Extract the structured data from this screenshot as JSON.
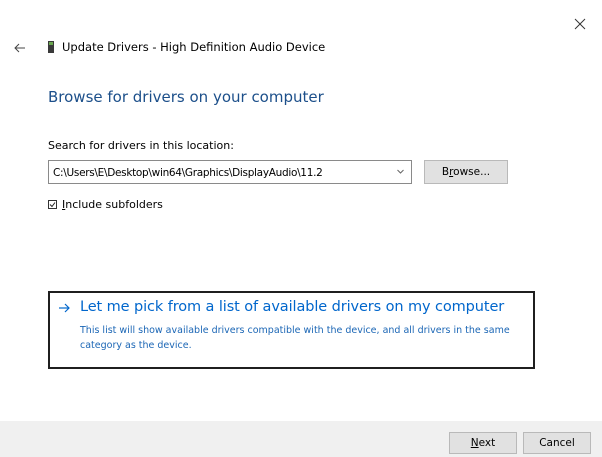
{
  "window": {
    "title": "Update Drivers - High Definition Audio Device",
    "close_icon": "close-icon",
    "back_icon": "back-arrow-icon",
    "device_icon": "audio-device-icon"
  },
  "main": {
    "heading": "Browse for drivers on your computer",
    "search_label": "Search for drivers in this location:",
    "path_value": "C:\\Users\\E\\Desktop\\win64\\Graphics\\DisplayAudio\\11.2",
    "browse_label_pre": "B",
    "browse_label_u": "r",
    "browse_label_post": "owse...",
    "include_checked": true,
    "include_label_u": "I",
    "include_label_post": "nclude subfolders",
    "pick_title": "Let me pick from a list of available drivers on my computer",
    "pick_description": "This list will show available drivers compatible with the device, and all drivers in the same category as the device."
  },
  "footer": {
    "next_label_u": "N",
    "next_label_post": "ext",
    "cancel_label": "Cancel"
  },
  "colors": {
    "heading": "#1c4f8a",
    "link": "#0066cc",
    "footer_bg": "#f0f0f0"
  }
}
